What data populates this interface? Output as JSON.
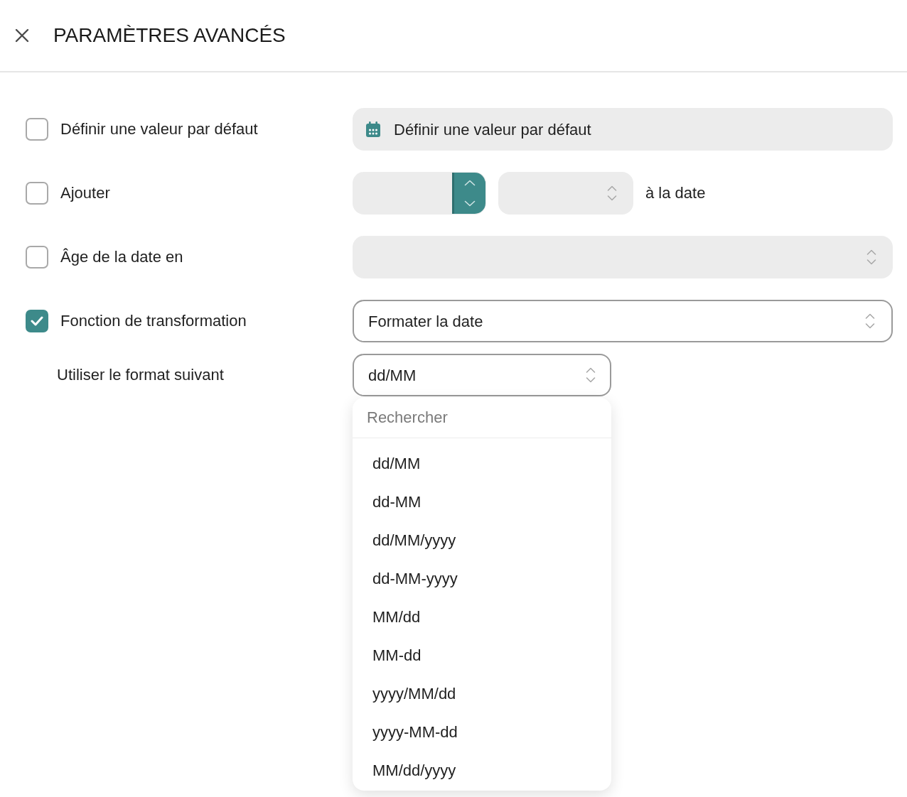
{
  "header": {
    "title": "PARAMÈTRES AVANCÉS"
  },
  "options": [
    {
      "kind": "date",
      "label": "Définir une valeur par défaut",
      "checked": false,
      "button": "Définir une valeur par défaut"
    },
    {
      "kind": "offset",
      "label": "Ajouter",
      "checked": false,
      "suffix": "à la date"
    },
    {
      "kind": "unit",
      "label": "Âge de la date en",
      "checked": false
    },
    {
      "kind": "select",
      "label": "Fonction de transformation",
      "checked": true,
      "value": "Formater la date"
    }
  ],
  "format": {
    "label": "Utiliser le format suivant",
    "value": "dd/MM",
    "expanded": true,
    "search": {
      "placeholder": "Rechercher"
    },
    "options": [
      "dd/MM",
      "dd-MM",
      "dd/MM/yyyy",
      "dd-MM-yyyy",
      "MM/dd",
      "MM-dd",
      "yyyy/MM/dd",
      "yyyy-MM-dd",
      "MM/dd/yyyy"
    ]
  }
}
